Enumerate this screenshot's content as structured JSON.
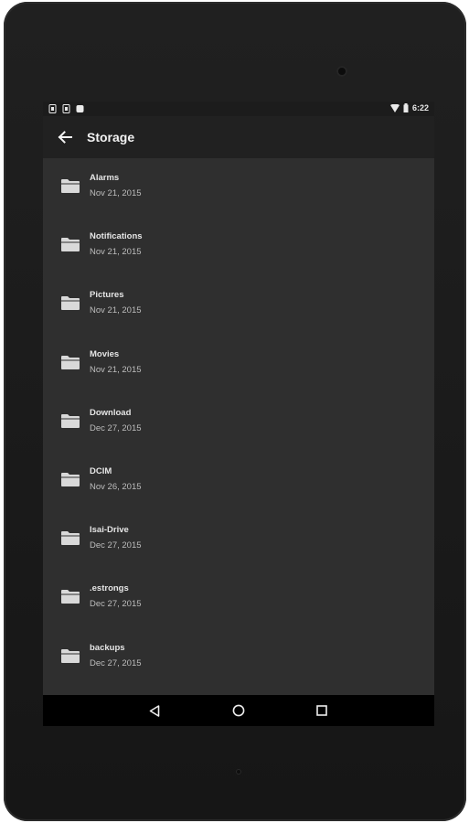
{
  "status_bar": {
    "time": "6:22",
    "left_icons": [
      "notification-icon",
      "notification-icon",
      "notification-icon"
    ],
    "right_icons": [
      "wifi-icon",
      "battery-icon"
    ]
  },
  "app_bar": {
    "title": "Storage",
    "back_icon": "arrow-back-icon"
  },
  "folders": [
    {
      "name": "Alarms",
      "date": "Nov 21, 2015"
    },
    {
      "name": "Notifications",
      "date": "Nov 21, 2015"
    },
    {
      "name": "Pictures",
      "date": "Nov 21, 2015"
    },
    {
      "name": "Movies",
      "date": "Nov 21, 2015"
    },
    {
      "name": "Download",
      "date": "Dec 27, 2015"
    },
    {
      "name": "DCIM",
      "date": "Nov 26, 2015"
    },
    {
      "name": "Isai-Drive",
      "date": "Dec 27, 2015"
    },
    {
      "name": ".estrongs",
      "date": "Dec 27, 2015"
    },
    {
      "name": "backups",
      "date": "Dec 27, 2015"
    }
  ],
  "nav_bar": {
    "buttons": [
      "back-triangle-icon",
      "home-circle-icon",
      "recents-square-icon"
    ]
  },
  "colors": {
    "screen_bg": "#2f2f2f",
    "app_bar_bg": "#212121",
    "device_body": "#1b1b1b"
  }
}
